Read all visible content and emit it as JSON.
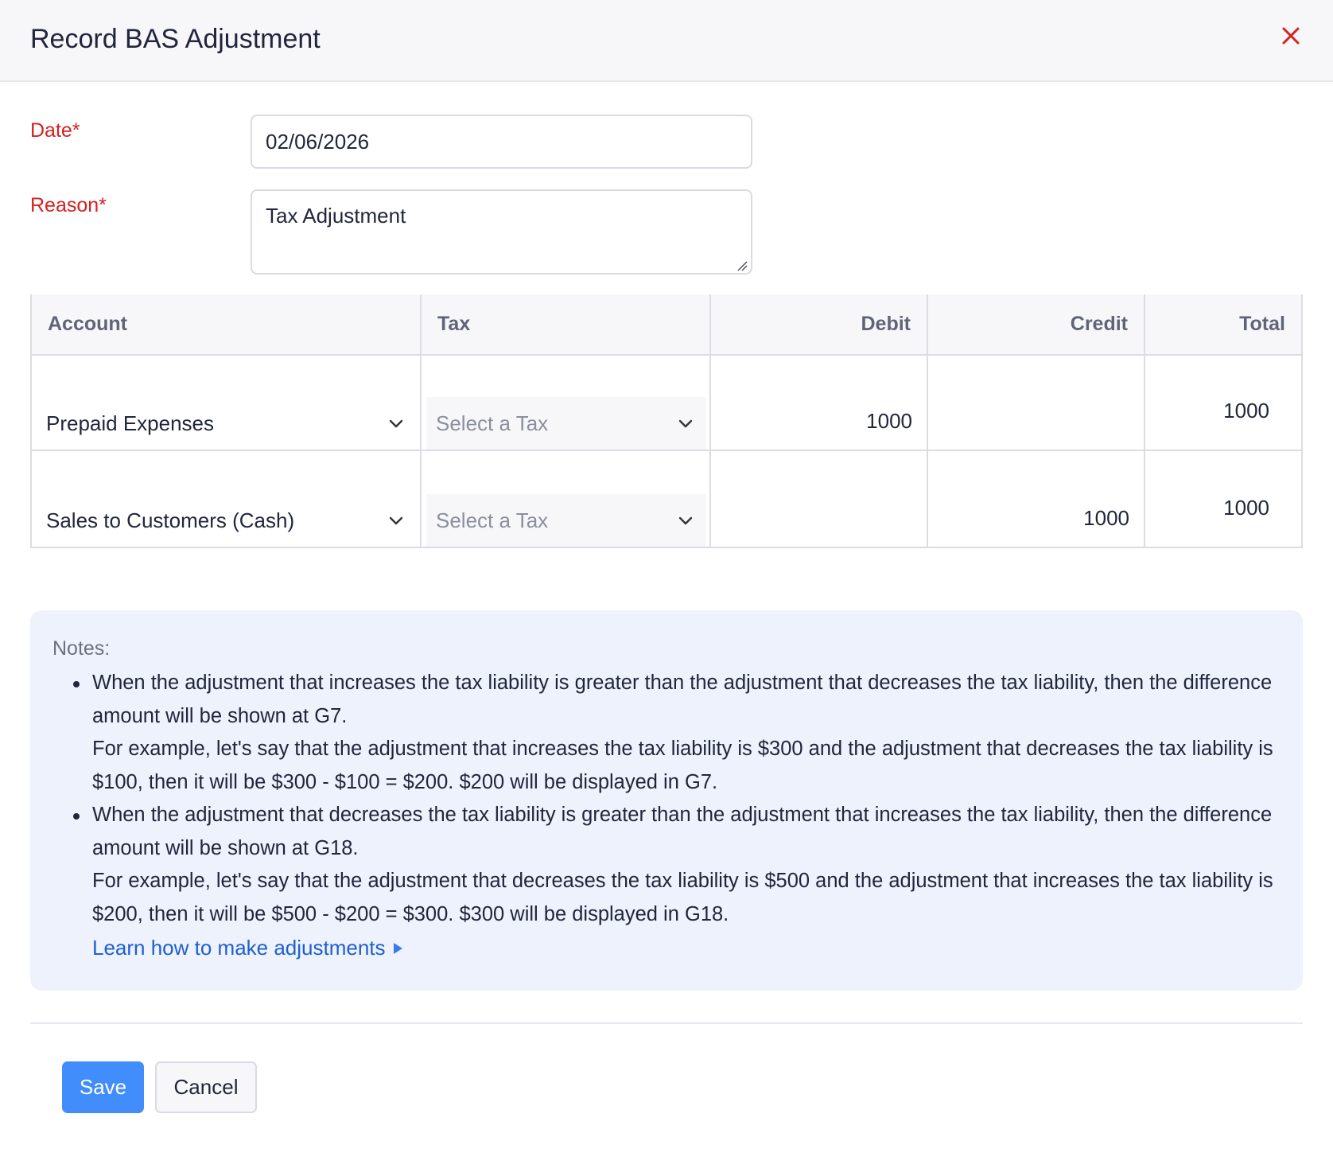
{
  "dialog": {
    "title": "Record BAS Adjustment",
    "close_icon": "close-icon",
    "accent_color": "#d6201f"
  },
  "form": {
    "date_label": "Date*",
    "date_value": "02/06/2026",
    "reason_label": "Reason*",
    "reason_value": "Tax Adjustment"
  },
  "table": {
    "headers": {
      "account": "Account",
      "tax": "Tax",
      "debit": "Debit",
      "credit": "Credit",
      "total": "Total"
    },
    "rows": [
      {
        "account": "Prepaid Expenses",
        "tax_placeholder": "Select a Tax",
        "debit": "1000",
        "credit": "",
        "total": "1000"
      },
      {
        "account": "Sales to Customers (Cash)",
        "tax_placeholder": "Select a Tax",
        "debit": "",
        "credit": "1000",
        "total": "1000"
      }
    ]
  },
  "notes": {
    "title": "Notes:",
    "items": [
      {
        "text": "When the adjustment that increases the tax liability is greater than the adjustment that decreases the tax liability, then the difference amount will be shown at G7.",
        "example": "For example, let's say that the adjustment that increases the tax liability is $300 and the adjustment that decreases the tax liability is $100, then it will be $300 - $100 = $200. $200 will be displayed in G7."
      },
      {
        "text": "When the adjustment that decreases the tax liability is greater than the adjustment that increases the tax liability, then the difference amount will be shown at G18.",
        "example": "For example, let's say that the adjustment that decreases the tax liability is $500 and the adjustment that increases the tax liability is $200, then it will be $500 - $200 = $300. $300 will be displayed in G18."
      }
    ],
    "link_label": "Learn how to make adjustments"
  },
  "footer": {
    "save_label": "Save",
    "cancel_label": "Cancel",
    "primary_color": "#408dfb"
  }
}
